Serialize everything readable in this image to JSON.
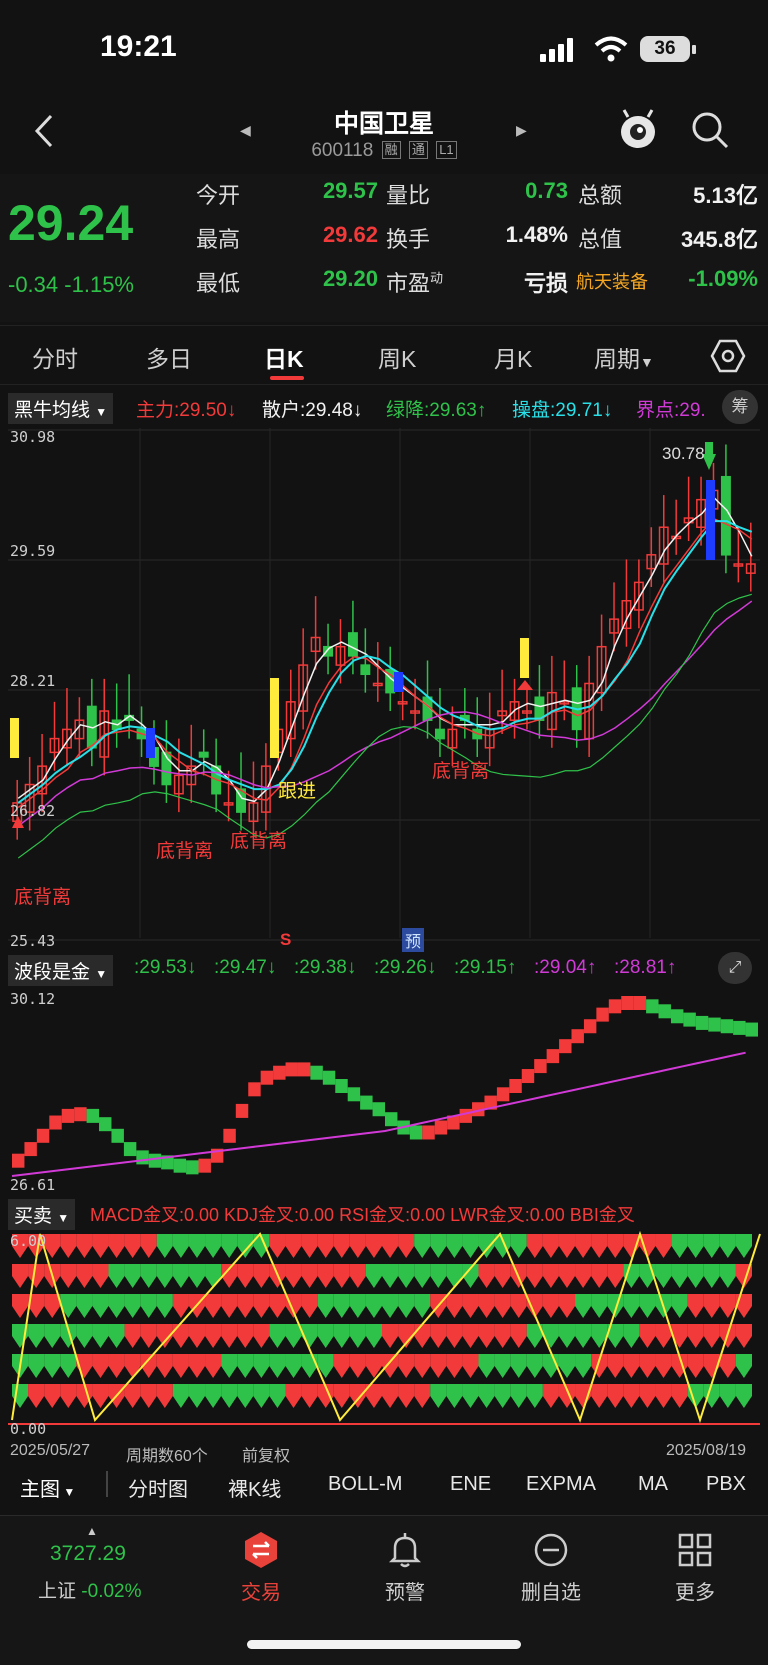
{
  "status": {
    "time": "19:21",
    "battery": "36"
  },
  "header": {
    "title": "中国卫星",
    "code": "600118",
    "tags": [
      "融",
      "通",
      "L1"
    ]
  },
  "quote": {
    "price": "29.24",
    "change": "-0.34",
    "change_pct": "-1.15%",
    "open_label": "今开",
    "open": "29.57",
    "high_label": "最高",
    "high": "29.62",
    "low_label": "最低",
    "low": "29.20",
    "vol_ratio_label": "量比",
    "vol_ratio": "0.73",
    "turnover_label": "换手",
    "turnover": "1.48%",
    "pe_label": "市盈",
    "pe_sup": "动",
    "pe": "亏损",
    "amount_label": "总额",
    "amount": "5.13亿",
    "mktcap_label": "总值",
    "mktcap": "345.8亿",
    "sector": "航天装备",
    "sector_pct": "-1.09%"
  },
  "tabs": [
    "分时",
    "多日",
    "日K",
    "周K",
    "月K",
    "周期"
  ],
  "main_indicator": {
    "name": "黑牛均线",
    "items": [
      {
        "label": "主力:29.50↓",
        "color": "#f23a3a"
      },
      {
        "label": "散户:29.48↓",
        "color": "#f2f2f2"
      },
      {
        "label": "绿降:29.63↑",
        "color": "#2fc24a"
      },
      {
        "label": "操盘:29.71↓",
        "color": "#29e0e8"
      },
      {
        "label": "界点:29.",
        "color": "#d23ad8"
      }
    ],
    "chip_label": "筹"
  },
  "price_axis": {
    "top": "30.98",
    "mid1": "29.59",
    "mid2": "28.21",
    "mid3": "26.82",
    "bottom": "25.43",
    "peak": "30.78"
  },
  "annotations": {
    "divergence": "底背离",
    "follow": "跟进",
    "s_mark": "S",
    "pre_mark": "预"
  },
  "wave": {
    "name": "波段是金",
    "values": [
      {
        "label": ":29.53↓",
        "color": "#2fc24a"
      },
      {
        "label": ":29.47↓",
        "color": "#2fc24a"
      },
      {
        "label": ":29.38↓",
        "color": "#2fc24a"
      },
      {
        "label": ":29.26↓",
        "color": "#2fc24a"
      },
      {
        "label": ":29.15↑",
        "color": "#2fc24a"
      },
      {
        "label": ":29.04↑",
        "color": "#d23ad8"
      },
      {
        "label": ":28.81↑",
        "color": "#d23ad8"
      }
    ],
    "top": "30.12",
    "bottom": "26.61"
  },
  "signals": {
    "name": "买卖",
    "text": "MACD金叉:0.00 KDJ金叉:0.00 RSI金叉:0.00 LWR金叉:0.00 BBI金叉",
    "top": "6.00",
    "bottom": "0.00"
  },
  "footer_info": {
    "start": "2025/05/27",
    "period": "周期数60个",
    "adjust": "前复权",
    "end": "2025/08/19"
  },
  "overlay_tabs": [
    "主图",
    "分时图",
    "裸K线",
    "BOLL-M",
    "ENE",
    "EXPMA",
    "MA",
    "PBX"
  ],
  "dock": {
    "index_value": "3727.29",
    "index_name": "上证",
    "index_pct": "-0.02%",
    "items": [
      "交易",
      "预警",
      "删自选",
      "更多"
    ]
  },
  "colors": {
    "up": "#f23a3a",
    "down": "#2fc24a",
    "bg": "#121212"
  }
}
